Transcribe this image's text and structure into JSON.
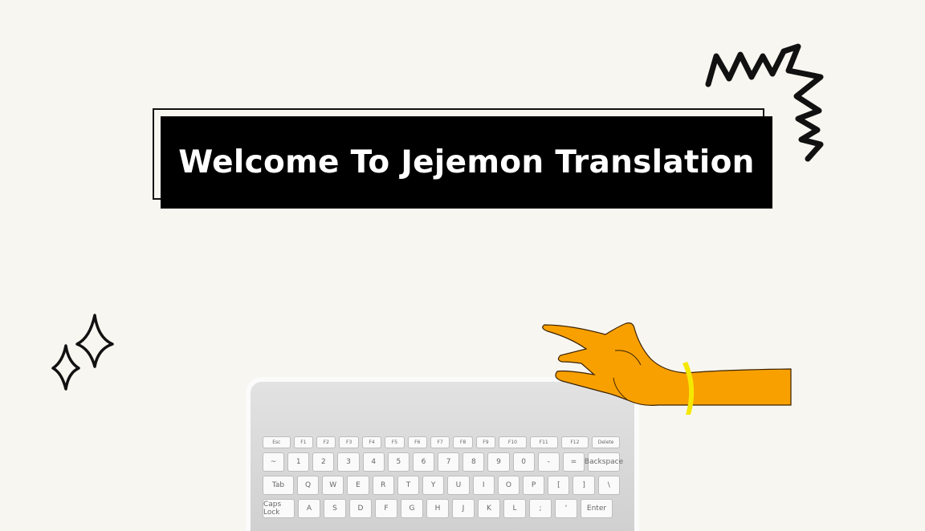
{
  "banner": {
    "title": "Welcome To Jejemon Translation"
  },
  "decorations": {
    "scribble": "zigzag-scribble",
    "sparkles": "sparkle-icon",
    "hand": "hand-illustration",
    "keyboard": "keyboard-illustration"
  },
  "keyboard": {
    "fn_row": [
      "Esc",
      "F1",
      "F2",
      "F3",
      "F4",
      "F5",
      "F6",
      "F7",
      "F8",
      "F9",
      "F10",
      "F11",
      "F12",
      "Delete"
    ],
    "num_row": [
      "~",
      "1",
      "2",
      "3",
      "4",
      "5",
      "6",
      "7",
      "8",
      "9",
      "0",
      "-",
      "=",
      "Backspace"
    ],
    "q_row": [
      "Tab",
      "Q",
      "W",
      "E",
      "R",
      "T",
      "Y",
      "U",
      "I",
      "O",
      "P",
      "[",
      "]",
      "\\"
    ],
    "a_row": [
      "Caps Lock",
      "A",
      "S",
      "D",
      "F",
      "G",
      "H",
      "J",
      "K",
      "L",
      ";",
      "'",
      "Enter"
    ]
  },
  "colors": {
    "background": "#f8f6f0",
    "banner": "#000000",
    "hand": "#f8a000",
    "bangle": "#f5e800"
  }
}
